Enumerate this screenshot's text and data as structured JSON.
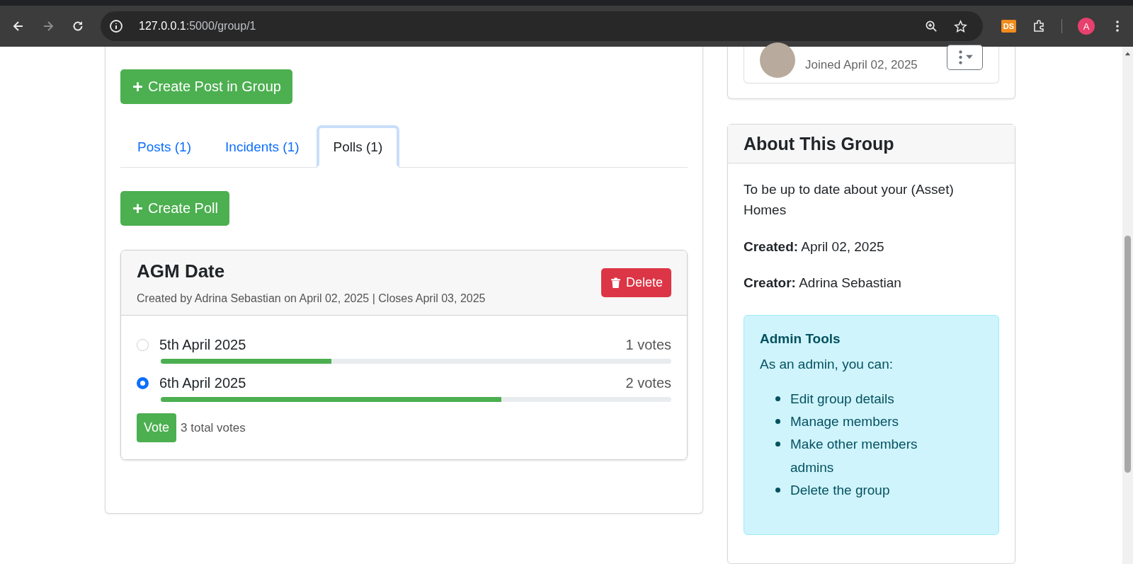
{
  "browser": {
    "url_host": "127.0.0.1",
    "url_path": ":5000/group/1",
    "extension_label": "DS",
    "profile_initial": "A"
  },
  "member": {
    "joined": "Joined April 02, 2025"
  },
  "create_post_button": "Create Post in Group",
  "tabs": [
    {
      "label": "Posts (1)",
      "selected": false
    },
    {
      "label": "Incidents (1)",
      "selected": false
    },
    {
      "label": "Polls (1)",
      "selected": true
    }
  ],
  "create_poll_button": "Create Poll",
  "poll": {
    "title": "AGM Date",
    "meta": "Created by Adrina Sebastian on April 02, 2025 | Closes April 03, 2025",
    "delete_button": "Delete",
    "options": [
      {
        "label": "5th April 2025",
        "votes": "1 votes",
        "selected": false,
        "level": 0.334
      },
      {
        "label": "6th April 2025",
        "votes": "2 votes",
        "selected": true,
        "level": 0.667
      }
    ],
    "vote_button": "Vote",
    "total": "3 total votes"
  },
  "about": {
    "title": "About This Group",
    "description": "To be up to date about your (Asset) Homes",
    "created": "**Created:** April 02, 2025",
    "creator": "**Creator:** Adrina Sebastian",
    "admin": {
      "title": "Admin Tools",
      "intro": "As an admin, you can:",
      "items": [
        "Edit group details",
        "Manage members",
        "Make other members admins",
        "Delete the group"
      ]
    }
  }
}
